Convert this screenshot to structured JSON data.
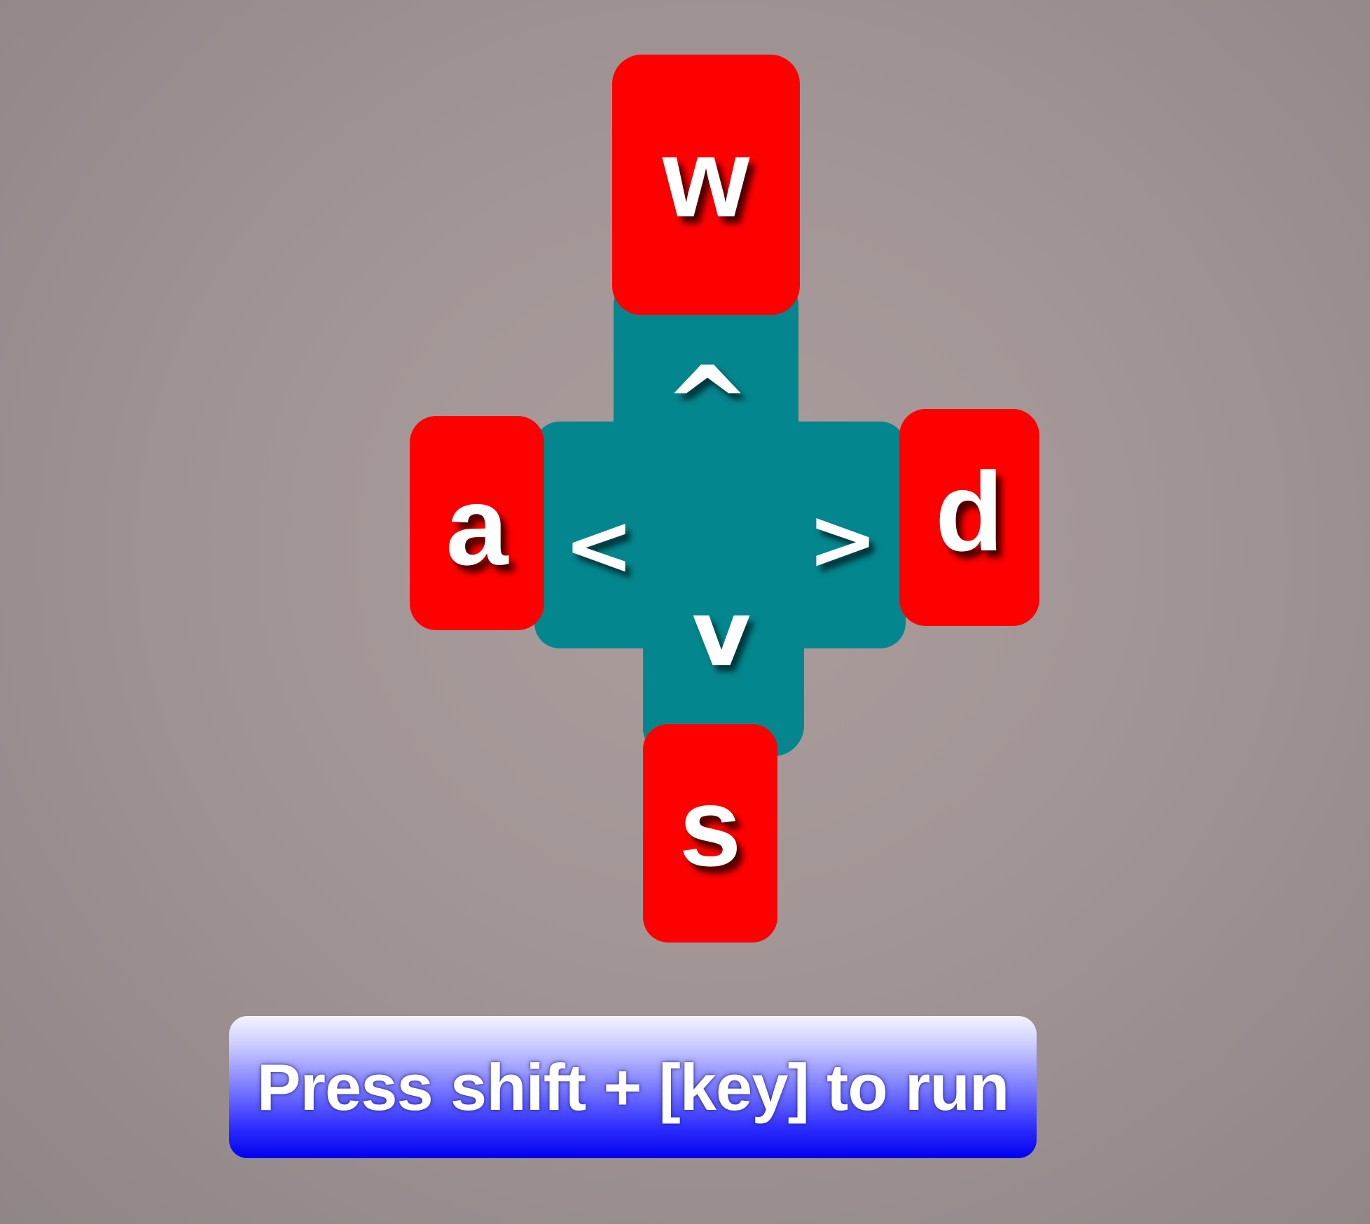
{
  "keys": {
    "up": "w",
    "left": "a",
    "right": "d",
    "down": "s"
  },
  "arrows": {
    "up": "^",
    "left": "<",
    "right": ">",
    "down": "v"
  },
  "hint": {
    "text": "Press shift + [key] to run"
  },
  "colors": {
    "key_fill": "#ff0000",
    "dpad_fill": "#03868d",
    "hint_gradient_top": "#f4f4ff",
    "hint_gradient_bottom": "#0000ee",
    "background": "#a39696"
  }
}
